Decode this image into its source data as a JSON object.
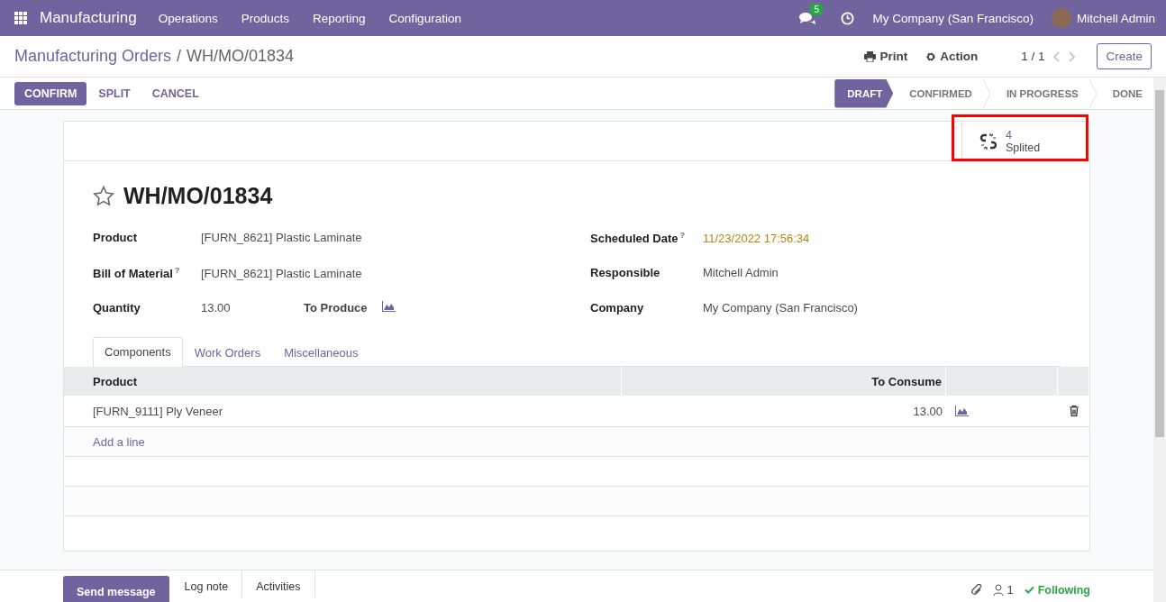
{
  "navbar": {
    "app_name": "Manufacturing",
    "menu": [
      "Operations",
      "Products",
      "Reporting",
      "Configuration"
    ],
    "messages_badge": "5",
    "company": "My Company (San Francisco)",
    "user": "Mitchell Admin"
  },
  "breadcrumb": {
    "parent": "Manufacturing Orders",
    "separator": "/",
    "current": "WH/MO/01834"
  },
  "control": {
    "print": "Print",
    "action": "Action",
    "pager": "1 / 1",
    "create": "Create"
  },
  "buttons": [
    {
      "label": "CONFIRM",
      "kind": "primary"
    },
    {
      "label": "SPLIT",
      "kind": "link"
    },
    {
      "label": "CANCEL",
      "kind": "link"
    }
  ],
  "stages": [
    {
      "label": "DRAFT",
      "selected": true
    },
    {
      "label": "CONFIRMED",
      "selected": false
    },
    {
      "label": "IN PROGRESS",
      "selected": false
    },
    {
      "label": "DONE",
      "selected": false
    }
  ],
  "smart_button": {
    "count": "4",
    "label": "Splited",
    "highlighted": true
  },
  "record": {
    "title": "WH/MO/01834",
    "starred": false
  },
  "fields_left": [
    {
      "label": "Product",
      "value": "[FURN_8621] Plastic Laminate",
      "kind": "text"
    },
    {
      "label": "Bill of Material",
      "help": "?",
      "value": "[FURN_8621] Plastic Laminate",
      "kind": "text"
    },
    {
      "label": "Quantity",
      "value": "13.00",
      "kind": "quantity",
      "extra_label": "To Produce"
    }
  ],
  "fields_right": [
    {
      "label": "Scheduled Date",
      "help": "?",
      "value": "11/23/2022 17:56:34",
      "kind": "date"
    },
    {
      "label": "Responsible",
      "value": "Mitchell Admin",
      "kind": "text"
    },
    {
      "label": "Company",
      "value": "My Company (San Francisco)",
      "kind": "text"
    }
  ],
  "tabs": [
    {
      "label": "Components",
      "selected": true
    },
    {
      "label": "Work Orders",
      "selected": false
    },
    {
      "label": "Miscellaneous",
      "selected": false
    }
  ],
  "table": {
    "columns": [
      "Product",
      "To Consume"
    ],
    "rows": [
      {
        "product": "[FURN_9111] Ply Veneer",
        "to_consume": "13.00"
      }
    ],
    "add_line": "Add a line"
  },
  "chatter": {
    "send": "Send message",
    "log": "Log note",
    "activities": "Activities",
    "followers": "1",
    "following": "Following"
  }
}
